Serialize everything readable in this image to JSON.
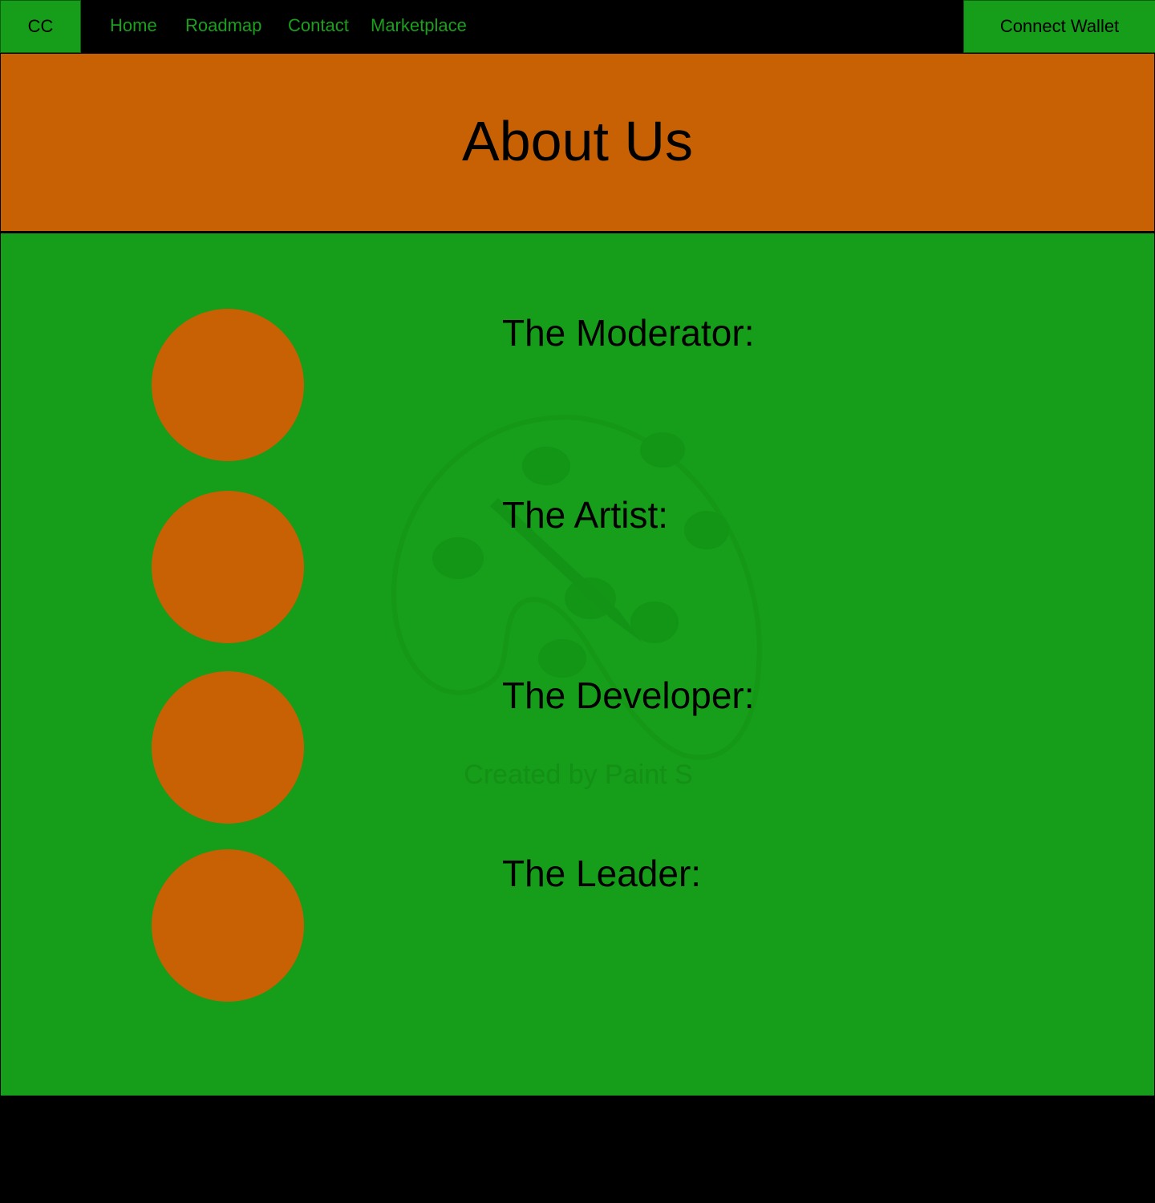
{
  "nav": {
    "logo": "CC",
    "links": [
      "Home",
      "Roadmap",
      "Contact",
      "Marketplace"
    ],
    "wallet_button": "Connect Wallet"
  },
  "hero": {
    "title": "About Us"
  },
  "team": {
    "roles": [
      "The Moderator:",
      "The Artist:",
      "The Developer:",
      "The Leader:"
    ]
  },
  "watermark": {
    "text": "Created by Paint S",
    "icon": "paint-palette-icon"
  },
  "colors": {
    "green": "#169d19",
    "orange": "#c86104",
    "black": "#000000"
  }
}
